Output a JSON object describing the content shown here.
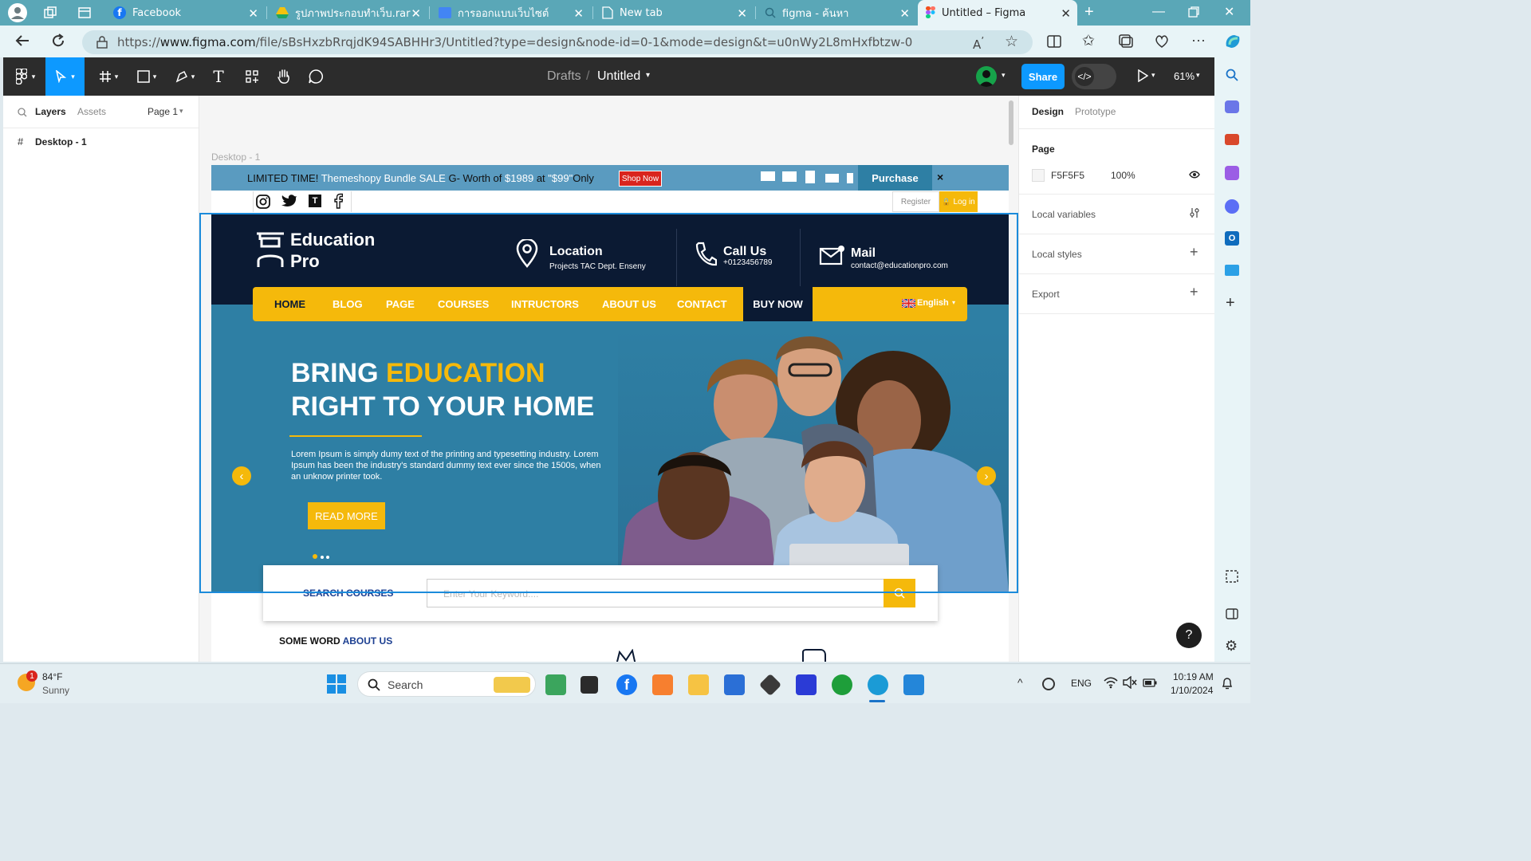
{
  "browser": {
    "tabs": [
      {
        "label": "Facebook",
        "icon": "facebook-icon"
      },
      {
        "label": "รูปภาพประกอบทำเว็บ.rar - G",
        "icon": "google-drive-icon"
      },
      {
        "label": "การออกแบบเว็บไซต์",
        "icon": "classroom-icon"
      },
      {
        "label": "New tab",
        "icon": "page-icon"
      },
      {
        "label": "figma - ค้นหา",
        "icon": "search-icon"
      },
      {
        "label": "Untitled – Figma",
        "icon": "figma-icon"
      }
    ],
    "url_prefix": "https://",
    "url_host": "www.figma.com",
    "url_path": "/file/sBsHxzbRrqjdK94SABHHr3/Untitled?type=design&node-id=0-1&mode=design&t=u0nWy2L8mHxfbtzw-0"
  },
  "figma": {
    "breadcrumb_parent": "Drafts",
    "breadcrumb_sep": "/",
    "file_name": "Untitled",
    "share_label": "Share",
    "zoom": "61%",
    "left_panel": {
      "tab_layers": "Layers",
      "tab_assets": "Assets",
      "page_select": "Page 1",
      "layer": "Desktop - 1"
    },
    "right_panel": {
      "tab_design": "Design",
      "tab_prototype": "Prototype",
      "page_heading": "Page",
      "page_color": "F5F5F5",
      "page_opacity": "100%",
      "local_variables": "Local variables",
      "local_styles": "Local styles",
      "export": "Export"
    },
    "frame_label": "Desktop - 1"
  },
  "design": {
    "topbar": {
      "text_limited": "LIMITED TIME!",
      "text_bundle": "Themeshopy Bundle SALE",
      "text_g": "G- Worth of",
      "text_price_old": "$1989",
      "text_at": "at",
      "text_price_new": "\"$99\"",
      "text_only": "Only",
      "shop_now": "Shop Now",
      "purchase": "Purchase",
      "close": "×"
    },
    "register": "Register",
    "login": "Log in",
    "brand_line1": "Education",
    "brand_line2": "Pro",
    "location_title": "Location",
    "location_text": "Projects TAC Dept. Enseny",
    "call_title": "Call Us",
    "call_text": "+0123456789",
    "mail_title": "Mail",
    "mail_text": "contact@educationpro.com",
    "nav": [
      "HOME",
      "BLOG",
      "PAGE",
      "COURSES",
      "INTRUCTORS",
      "ABOUT US",
      "CONTACT"
    ],
    "buy_now": "BUY NOW",
    "language": "English",
    "hero_title_a": "BRING ",
    "hero_title_b": "EDUCATION",
    "hero_title_c": "RIGHT TO YOUR HOME",
    "hero_text": "Lorem Ipsum is simply dumy text of the printing and typesetting industry. Lorem Ipsum has been the industry's standard dummy text ever since the 1500s, when an unknow printer took.",
    "read_more": "READ MORE",
    "search_label": "SEARCH COURSES",
    "search_placeholder": "Enter Your Keyword....",
    "about_a": "SOME WORD ",
    "about_b": "ABOUT US"
  },
  "taskbar": {
    "weather_temp": "84°F",
    "weather_text": "Sunny",
    "weather_badge": "1",
    "search": "Search",
    "lang": "ENG",
    "time": "10:19 AM",
    "date": "1/10/2024"
  },
  "colors": {
    "accent_yellow": "#f5b90b",
    "hero_blue": "#2e7fa4",
    "header_navy": "#0b1a33",
    "figma_blue": "#0d99ff"
  }
}
